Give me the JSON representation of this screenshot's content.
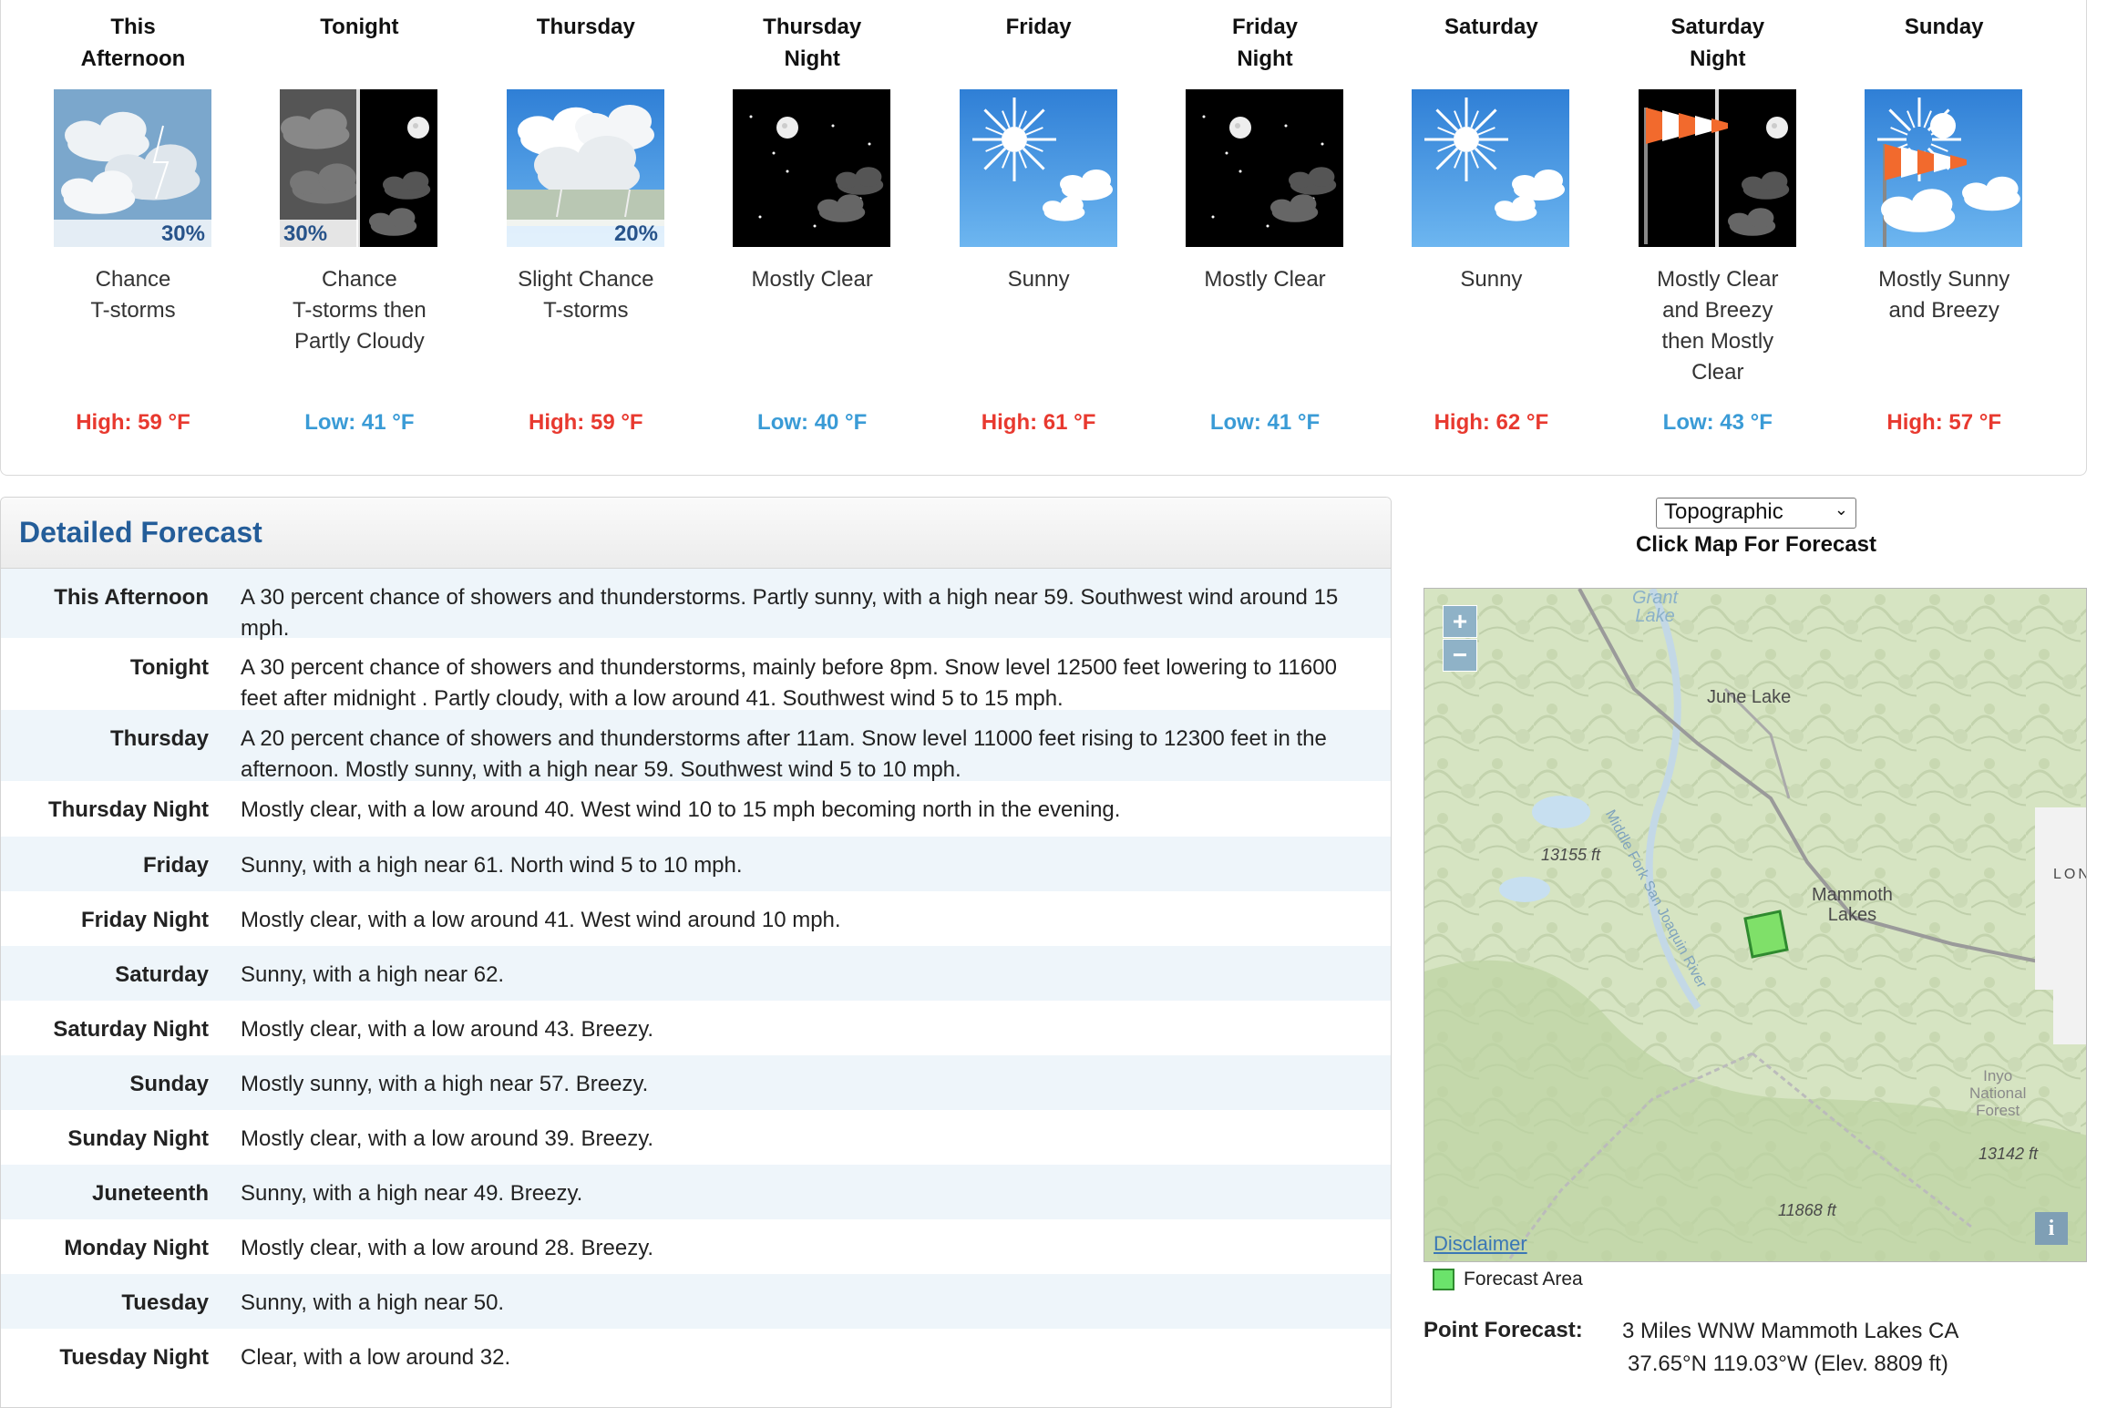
{
  "seven_day": [
    {
      "name": "This\nAfternoon",
      "desc": "Chance\nT-storms",
      "temp": "High: 59 °F",
      "type": "high",
      "icon": "tstorm-day-icon",
      "pop": "30%"
    },
    {
      "name": "Tonight",
      "desc": "Chance\nT-storms then\nPartly Cloudy",
      "temp": "Low: 41 °F",
      "type": "low",
      "icon": "tstorm-then-partly-cloudy-night-icon",
      "pop": "30%"
    },
    {
      "name": "Thursday",
      "desc": "Slight Chance\nT-storms",
      "temp": "High: 59 °F",
      "type": "high",
      "icon": "slight-tstorm-day-icon",
      "pop": "20%"
    },
    {
      "name": "Thursday\nNight",
      "desc": "Mostly Clear",
      "temp": "Low: 40 °F",
      "type": "low",
      "icon": "mostly-clear-night-icon",
      "pop": ""
    },
    {
      "name": "Friday",
      "desc": "Sunny",
      "temp": "High: 61 °F",
      "type": "high",
      "icon": "sunny-icon",
      "pop": ""
    },
    {
      "name": "Friday\nNight",
      "desc": "Mostly Clear",
      "temp": "Low: 41 °F",
      "type": "low",
      "icon": "mostly-clear-night-icon",
      "pop": ""
    },
    {
      "name": "Saturday",
      "desc": "Sunny",
      "temp": "High: 62 °F",
      "type": "high",
      "icon": "sunny-icon",
      "pop": ""
    },
    {
      "name": "Saturday\nNight",
      "desc": "Mostly Clear\nand Breezy\nthen Mostly\nClear",
      "temp": "Low: 43 °F",
      "type": "low",
      "icon": "windsock-night-icon",
      "pop": ""
    },
    {
      "name": "Sunday",
      "desc": "Mostly Sunny\nand Breezy",
      "temp": "High: 57 °F",
      "type": "high",
      "icon": "windsock-day-icon",
      "pop": ""
    }
  ],
  "detailed": {
    "title": "Detailed Forecast",
    "rows": [
      {
        "label": "This Afternoon",
        "text": "A 30 percent chance of showers and thunderstorms. Partly sunny, with a high near 59. Southwest wind around 15 mph."
      },
      {
        "label": "Tonight",
        "text": "A 30 percent chance of showers and thunderstorms, mainly before 8pm. Snow level 12500 feet lowering to 11600 feet after midnight . Partly cloudy, with a low around 41. Southwest wind 5 to 15 mph."
      },
      {
        "label": "Thursday",
        "text": "A 20 percent chance of showers and thunderstorms after 11am. Snow level 11000 feet rising to 12300 feet in the afternoon. Mostly sunny, with a high near 59. Southwest wind 5 to 10 mph."
      },
      {
        "label": "Thursday Night",
        "text": "Mostly clear, with a low around 40. West wind 10 to 15 mph becoming north in the evening."
      },
      {
        "label": "Friday",
        "text": "Sunny, with a high near 61. North wind 5 to 10 mph."
      },
      {
        "label": "Friday Night",
        "text": "Mostly clear, with a low around 41. West wind around 10 mph."
      },
      {
        "label": "Saturday",
        "text": "Sunny, with a high near 62."
      },
      {
        "label": "Saturday Night",
        "text": "Mostly clear, with a low around 43. Breezy."
      },
      {
        "label": "Sunday",
        "text": "Mostly sunny, with a high near 57. Breezy."
      },
      {
        "label": "Sunday Night",
        "text": "Mostly clear, with a low around 39. Breezy."
      },
      {
        "label": "Juneteenth",
        "text": "Sunny, with a high near 49. Breezy."
      },
      {
        "label": "Monday Night",
        "text": "Mostly clear, with a low around 28. Breezy."
      },
      {
        "label": "Tuesday",
        "text": "Sunny, with a high near 50."
      },
      {
        "label": "Tuesday Night",
        "text": "Clear, with a low around 32."
      }
    ]
  },
  "map_panel": {
    "map_type": "Topographic",
    "click_label": "Click Map For Forecast",
    "zoom_in": "+",
    "zoom_out": "−",
    "labels": {
      "grant_lake": "Grant\nLake",
      "june_lake": "June Lake",
      "elev1": "13155 ft",
      "river": "Middle Fork San Joaquin River",
      "mammoth": "Mammoth\nLakes",
      "lon": "LON",
      "inyo": "Inyo\nNational\nForest",
      "elev2": "13142 ft",
      "elev3": "11868 ft"
    },
    "disclaimer": "Disclaimer",
    "info": "i",
    "legend": "Forecast Area",
    "point_label": "Point Forecast:",
    "point_line1": "3 Miles WNW Mammoth Lakes CA",
    "point_line2": "37.65°N 119.03°W (Elev. 8809 ft)"
  },
  "colors": {
    "high": "#e8392f",
    "low": "#3a9bd6",
    "title": "#245d99"
  }
}
